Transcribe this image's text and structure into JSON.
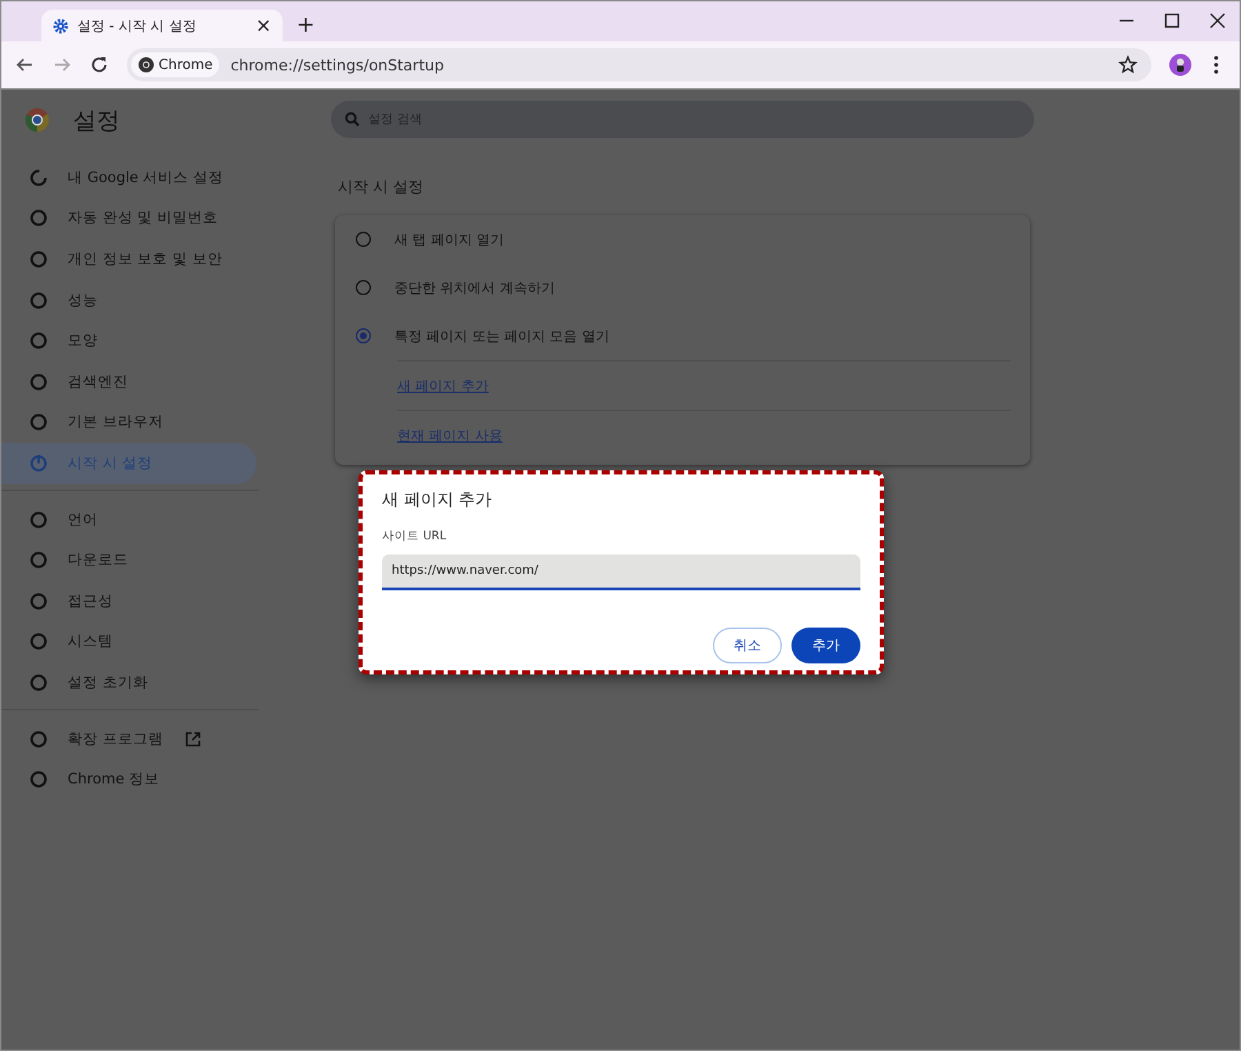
{
  "window": {
    "tab_title": "설정 - 시작 시 설정",
    "tab_close": "×",
    "new_tab": "+"
  },
  "toolbar": {
    "chip": "Chrome",
    "url": "chrome://settings/onStartup"
  },
  "sidebar": {
    "title": "설정",
    "sections": [
      [
        {
          "label": "내 Google 서비스 설정",
          "selected": false,
          "external": false
        },
        {
          "label": "자동 완성 및 비밀번호",
          "selected": false,
          "external": false
        },
        {
          "label": "개인 정보 보호 및 보안",
          "selected": false,
          "external": false
        },
        {
          "label": "성능",
          "selected": false,
          "external": false
        },
        {
          "label": "모양",
          "selected": false,
          "external": false
        },
        {
          "label": "검색엔진",
          "selected": false,
          "external": false
        },
        {
          "label": "기본 브라우저",
          "selected": false,
          "external": false
        },
        {
          "label": "시작 시 설정",
          "selected": true,
          "external": false
        }
      ],
      [
        {
          "label": "언어",
          "selected": false,
          "external": false
        },
        {
          "label": "다운로드",
          "selected": false,
          "external": false
        },
        {
          "label": "접근성",
          "selected": false,
          "external": false
        },
        {
          "label": "시스템",
          "selected": false,
          "external": false
        },
        {
          "label": "설정 초기화",
          "selected": false,
          "external": false
        }
      ],
      [
        {
          "label": "확장 프로그램",
          "selected": false,
          "external": true
        },
        {
          "label": "Chrome 정보",
          "selected": false,
          "external": false
        }
      ]
    ]
  },
  "search": {
    "placeholder": "설정 검색"
  },
  "section_title": "시작 시 설정",
  "options": [
    {
      "label": "새 탭 페이지 열기",
      "selected": false
    },
    {
      "label": "중단한 위치에서 계속하기",
      "selected": false
    },
    {
      "label": "특정 페이지 또는 페이지 모음 열기",
      "selected": true
    }
  ],
  "links": [
    "새 페이지 추가",
    "현재 페이지 사용"
  ],
  "dialog": {
    "title": "새 페이지 추가",
    "field_label": "사이트 URL",
    "field_value": "https://www.naver.com/",
    "buttons": [
      {
        "label": "취소",
        "kind": "secondary"
      },
      {
        "label": "추가",
        "kind": "primary"
      }
    ]
  }
}
